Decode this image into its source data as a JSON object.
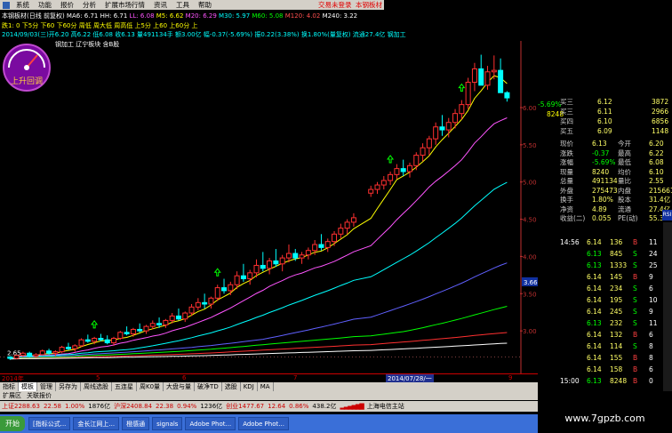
{
  "menu": {
    "items": [
      "系统",
      "功能",
      "报价",
      "分析",
      "扩展市场行情",
      "资讯",
      "工具",
      "帮助"
    ],
    "trade_link": "交易未登录",
    "title_link": "本钢板材"
  },
  "header": {
    "title_line": "本钢板材(日线 前复权)",
    "ma_line": [
      "MA6: 6.71",
      "HH: 6.71",
      "LL: 6.08",
      "M5: 6.62",
      "M20: 6.29",
      "M30: 5.97",
      "M60: 5.08",
      "M120: 4.02",
      "M240: 3.22"
    ],
    "signal_line": [
      "跌1: 0",
      "下5分",
      "下60",
      "下60分",
      "周低",
      "周大低",
      "周高低",
      "上5分",
      "上60",
      "上60分",
      "上"
    ],
    "date_line": "2014/09/03(三)开6.20 高6.22 低6.08 收6.13 量491134手 额3.00亿 幅-0.37(-5.69%) 振0.22(3.38%) 换1.80%(量复权) 流通27.4亿 钢加工",
    "tags": [
      "钢加工",
      "辽宁板块",
      "含B股"
    ]
  },
  "gauge": {
    "label": "上升回调"
  },
  "chart_data": {
    "type": "candlestick",
    "title": "本钢板材(日线 前复权)",
    "x_labels": [
      "2014年",
      "5",
      "6",
      "7",
      "2014/07/28/一",
      "9"
    ],
    "y_labels": [
      "6.00",
      "5.50",
      "5.00",
      "4.50",
      "4.00",
      "3.50",
      "3.00",
      "2.65"
    ],
    "last_price_marker": "3.66",
    "series_ma": [
      {
        "name": "MA6",
        "value": 6.71,
        "color": "#ffffff"
      },
      {
        "name": "M5",
        "value": 6.62,
        "color": "#ff55ff"
      },
      {
        "name": "M20",
        "value": 6.29,
        "color": "#ffff00"
      },
      {
        "name": "M30",
        "value": 5.97,
        "color": "#00ffff"
      },
      {
        "name": "M60",
        "value": 5.08,
        "color": "#00ff00"
      },
      {
        "name": "M120",
        "value": 4.02,
        "color": "#ff3030"
      },
      {
        "name": "M240",
        "value": 3.22,
        "color": "#ffffff"
      }
    ],
    "candles": [
      [
        2.65,
        2.66,
        2.61,
        2.63
      ],
      [
        2.63,
        2.68,
        2.62,
        2.67
      ],
      [
        2.67,
        2.72,
        2.65,
        2.7
      ],
      [
        2.7,
        2.72,
        2.64,
        2.66
      ],
      [
        2.66,
        2.7,
        2.64,
        2.68
      ],
      [
        2.68,
        2.75,
        2.67,
        2.73
      ],
      [
        2.73,
        2.76,
        2.68,
        2.7
      ],
      [
        2.7,
        2.74,
        2.66,
        2.72
      ],
      [
        2.72,
        2.8,
        2.7,
        2.78
      ],
      [
        2.78,
        2.84,
        2.74,
        2.76
      ],
      [
        2.76,
        2.82,
        2.72,
        2.8
      ],
      [
        2.8,
        2.9,
        2.78,
        2.88
      ],
      [
        2.88,
        2.95,
        2.84,
        2.86
      ],
      [
        2.86,
        2.92,
        2.82,
        2.9
      ],
      [
        2.9,
        2.96,
        2.86,
        2.88
      ],
      [
        2.88,
        2.94,
        2.82,
        2.84
      ],
      [
        2.84,
        2.92,
        2.8,
        2.9
      ],
      [
        2.9,
        3.0,
        2.88,
        2.98
      ],
      [
        2.98,
        3.06,
        2.94,
        2.96
      ],
      [
        2.96,
        3.04,
        2.92,
        3.02
      ],
      [
        3.02,
        3.1,
        2.98,
        3.0
      ],
      [
        3.0,
        3.08,
        2.96,
        3.06
      ],
      [
        3.06,
        3.14,
        3.02,
        3.1
      ],
      [
        3.1,
        3.18,
        3.04,
        3.08
      ],
      [
        3.08,
        3.16,
        3.04,
        3.14
      ],
      [
        3.14,
        3.24,
        3.1,
        3.2
      ],
      [
        3.2,
        3.3,
        3.14,
        3.16
      ],
      [
        3.16,
        3.26,
        3.12,
        3.24
      ],
      [
        3.24,
        3.36,
        3.2,
        3.32
      ],
      [
        3.32,
        3.44,
        3.28,
        3.38
      ],
      [
        3.38,
        3.5,
        3.3,
        3.36
      ],
      [
        3.36,
        3.46,
        3.3,
        3.44
      ],
      [
        3.44,
        3.62,
        3.4,
        3.58
      ],
      [
        3.58,
        3.7,
        3.5,
        3.54
      ],
      [
        3.54,
        3.66,
        3.48,
        3.62
      ],
      [
        3.62,
        3.8,
        3.56,
        3.74
      ],
      [
        3.74,
        3.9,
        3.66,
        3.7
      ],
      [
        3.7,
        3.82,
        3.62,
        3.78
      ],
      [
        3.78,
        3.96,
        3.72,
        3.88
      ],
      [
        3.88,
        4.06,
        3.8,
        3.84
      ],
      [
        3.84,
        3.98,
        3.76,
        3.94
      ],
      [
        3.94,
        4.1,
        3.86,
        3.9
      ],
      [
        3.9,
        4.02,
        3.8,
        3.98
      ],
      [
        3.98,
        4.16,
        3.92,
        4.04
      ],
      [
        4.04,
        4.1,
        3.94,
        3.98
      ],
      [
        3.98,
        4.06,
        3.9,
        4.02
      ],
      [
        4.02,
        4.12,
        3.96,
        4.08
      ],
      [
        4.08,
        4.22,
        4.02,
        4.16
      ],
      [
        4.16,
        4.3,
        4.08,
        4.12
      ],
      [
        4.12,
        4.24,
        4.06,
        4.2
      ],
      [
        4.2,
        4.34,
        4.14,
        4.3
      ],
      [
        4.3,
        4.44,
        4.24,
        4.38
      ],
      [
        4.38,
        4.5,
        4.3,
        4.46
      ],
      [
        4.46,
        4.58,
        4.4,
        4.52
      ],
      [
        4.85,
        4.95,
        4.8,
        4.9
      ],
      [
        4.9,
        5.0,
        4.84,
        4.96
      ],
      [
        4.96,
        5.08,
        4.9,
        5.02
      ],
      [
        5.02,
        5.14,
        4.96,
        5.1
      ],
      [
        5.1,
        5.24,
        5.04,
        5.18
      ],
      [
        5.18,
        5.3,
        5.08,
        5.14
      ],
      [
        5.14,
        5.26,
        5.06,
        5.22
      ],
      [
        5.22,
        5.4,
        5.16,
        5.36
      ],
      [
        5.36,
        5.52,
        5.28,
        5.46
      ],
      [
        5.46,
        5.62,
        5.36,
        5.58
      ],
      [
        5.58,
        5.8,
        5.5,
        5.74
      ],
      [
        5.74,
        5.9,
        5.62,
        5.7
      ],
      [
        5.7,
        5.86,
        5.6,
        5.8
      ],
      [
        5.8,
        5.98,
        5.72,
        5.92
      ],
      [
        5.92,
        6.1,
        5.84,
        6.04
      ],
      [
        6.04,
        6.4,
        5.98,
        6.34
      ],
      [
        6.34,
        6.6,
        6.22,
        6.52
      ],
      [
        6.52,
        6.71,
        6.4,
        6.3
      ],
      [
        6.3,
        6.56,
        6.24,
        6.48
      ],
      [
        6.48,
        6.7,
        6.38,
        6.5
      ],
      [
        6.5,
        6.66,
        6.2,
        6.2
      ],
      [
        6.2,
        6.22,
        6.08,
        6.13
      ]
    ]
  },
  "xaxis_labels": [
    "2014年",
    "5",
    "6",
    "7",
    "2014/07/28/一",
    "9"
  ],
  "tabs": [
    "指标",
    "模板",
    "管理",
    "另存为",
    "周线选股",
    "五连星",
    "周K0量",
    "大盘与量",
    "破净TD",
    "选股",
    "KDJ",
    "MA"
  ],
  "ext": [
    "扩展区",
    "关联报价"
  ],
  "status": {
    "sh": "上证2288.63",
    "sh_chg": "22.58",
    "sh_pct": "1.00%",
    "sh_amt": "1876亿",
    "sz": "沪深2408.84",
    "sz_chg": "22.38",
    "sz_pct": "0.94%",
    "sz_amt": "1236亿",
    "cy": "创业1477.67",
    "cy_chg": "12.64",
    "cy_pct": "0.86%",
    "cy_amt": "438.2亿",
    "server": "上海电信主站"
  },
  "taskbar": {
    "start": "开始",
    "tasks": [
      "[指标公式...",
      "金长江网上...",
      "橙感通",
      "signals",
      "Adobe Phot...",
      "Adobe Phot..."
    ]
  },
  "quotes": {
    "top_pct": "-5.69%",
    "top_vol": "8248",
    "ask": [
      {
        "label": "买三",
        "price": "6.12",
        "vol": "3872"
      },
      {
        "label": "买三",
        "price": "6.11",
        "vol": "2966"
      },
      {
        "label": "买四",
        "price": "6.10",
        "vol": "6856"
      },
      {
        "label": "买五",
        "price": "6.09",
        "vol": "1148"
      }
    ],
    "info": [
      {
        "l": "现价",
        "v": "6.13",
        "l2": "今开",
        "v2": "6.20"
      },
      {
        "l": "涨跌",
        "v": "-0.37",
        "l2": "最高",
        "v2": "6.22"
      },
      {
        "l": "涨幅",
        "v": "-5.69%",
        "l2": "最低",
        "v2": "6.08"
      },
      {
        "l": "现量",
        "v": "8240",
        "l2": "均价",
        "v2": "6.10"
      },
      {
        "l": "总量",
        "v": "491134",
        "l2": "量比",
        "v2": "2.55"
      },
      {
        "l": "外盘",
        "v": "275473",
        "l2": "内盘",
        "v2": "215661"
      },
      {
        "l": "换手",
        "v": "1.80%",
        "l2": "股本",
        "v2": "31.4亿"
      },
      {
        "l": "净资",
        "v": "4.89",
        "l2": "流通",
        "v2": "27.4亿"
      },
      {
        "l": "收益(二)",
        "v": "0.055",
        "l2": "PE(动)",
        "v2": "55.3"
      }
    ],
    "ticks": [
      {
        "t": "14:56",
        "p": "6.14",
        "v": "136",
        "d": "B",
        "n": "11"
      },
      {
        "t": "",
        "p": "6.13",
        "v": "845",
        "d": "S",
        "n": "24"
      },
      {
        "t": "",
        "p": "6.13",
        "v": "1333",
        "d": "S",
        "n": "25"
      },
      {
        "t": "",
        "p": "6.14",
        "v": "145",
        "d": "B",
        "n": "9"
      },
      {
        "t": "",
        "p": "6.14",
        "v": "234",
        "d": "S",
        "n": "6"
      },
      {
        "t": "",
        "p": "6.14",
        "v": "195",
        "d": "S",
        "n": "10"
      },
      {
        "t": "",
        "p": "6.14",
        "v": "245",
        "d": "S",
        "n": "9"
      },
      {
        "t": "",
        "p": "6.13",
        "v": "232",
        "d": "S",
        "n": "11"
      },
      {
        "t": "",
        "p": "6.14",
        "v": "132",
        "d": "B",
        "n": "6"
      },
      {
        "t": "",
        "p": "6.14",
        "v": "114",
        "d": "S",
        "n": "8"
      },
      {
        "t": "",
        "p": "6.14",
        "v": "155",
        "d": "B",
        "n": "8"
      },
      {
        "t": "",
        "p": "6.14",
        "v": "158",
        "d": "B",
        "n": "6"
      },
      {
        "t": "15:00",
        "p": "6.13",
        "v": "8248",
        "d": "B",
        "n": "0"
      }
    ],
    "watermark": "www.7gpzb.com"
  }
}
